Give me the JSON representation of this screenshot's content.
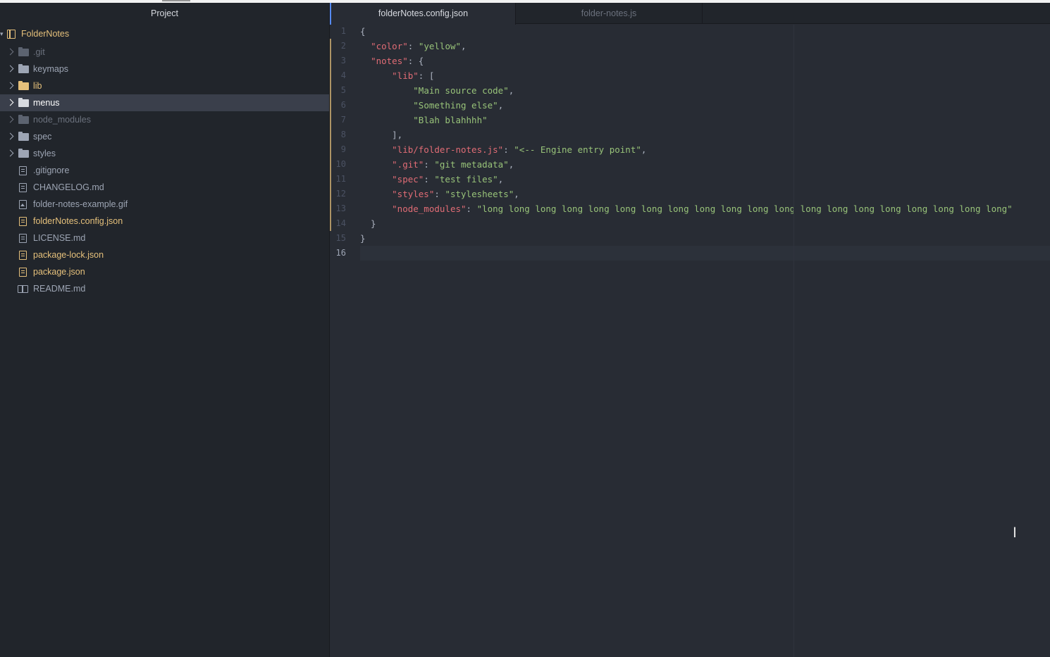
{
  "tree": {
    "header": "Project",
    "root": "FolderNotes",
    "items": [
      {
        "label": ".git",
        "kind": "folder",
        "state": "dim"
      },
      {
        "label": "keymaps",
        "kind": "folder",
        "state": ""
      },
      {
        "label": "lib",
        "kind": "folder",
        "state": "gold"
      },
      {
        "label": "menus",
        "kind": "folder",
        "state": "selected"
      },
      {
        "label": "node_modules",
        "kind": "folder",
        "state": "dim"
      },
      {
        "label": "spec",
        "kind": "folder",
        "state": ""
      },
      {
        "label": "styles",
        "kind": "folder",
        "state": ""
      },
      {
        "label": ".gitignore",
        "kind": "file",
        "state": ""
      },
      {
        "label": "CHANGELOG.md",
        "kind": "file",
        "state": ""
      },
      {
        "label": "folder-notes-example.gif",
        "kind": "image",
        "state": ""
      },
      {
        "label": "folderNotes.config.json",
        "kind": "file",
        "state": "gold"
      },
      {
        "label": "LICENSE.md",
        "kind": "file",
        "state": ""
      },
      {
        "label": "package-lock.json",
        "kind": "file",
        "state": "gold"
      },
      {
        "label": "package.json",
        "kind": "file",
        "state": "gold"
      },
      {
        "label": "README.md",
        "kind": "book",
        "state": ""
      }
    ]
  },
  "tabs": [
    {
      "label": "folderNotes.config.json",
      "active": true
    },
    {
      "label": "folder-notes.js",
      "active": false
    }
  ],
  "editor": {
    "line_numbers": [
      "1",
      "2",
      "3",
      "4",
      "5",
      "6",
      "7",
      "8",
      "9",
      "10",
      "11",
      "12",
      "13",
      "14",
      "15",
      "16"
    ],
    "lines": [
      [
        [
          "p",
          "{"
        ]
      ],
      [
        [
          "p",
          "  "
        ],
        [
          "k",
          "\"color\""
        ],
        [
          "p",
          ": "
        ],
        [
          "s",
          "\"yellow\""
        ],
        [
          "p",
          ","
        ]
      ],
      [
        [
          "p",
          "  "
        ],
        [
          "k",
          "\"notes\""
        ],
        [
          "p",
          ": {"
        ]
      ],
      [
        [
          "p",
          "      "
        ],
        [
          "k",
          "\"lib\""
        ],
        [
          "p",
          ": ["
        ]
      ],
      [
        [
          "p",
          "          "
        ],
        [
          "s",
          "\"Main source code\""
        ],
        [
          "p",
          ","
        ]
      ],
      [
        [
          "p",
          "          "
        ],
        [
          "s",
          "\"Something else\""
        ],
        [
          "p",
          ","
        ]
      ],
      [
        [
          "p",
          "          "
        ],
        [
          "s",
          "\"Blah blahhhh\""
        ]
      ],
      [
        [
          "p",
          "      ],"
        ]
      ],
      [
        [
          "p",
          "      "
        ],
        [
          "k",
          "\"lib/folder-notes.js\""
        ],
        [
          "p",
          ": "
        ],
        [
          "s",
          "\"<-- Engine entry point\""
        ],
        [
          "p",
          ","
        ]
      ],
      [
        [
          "p",
          "      "
        ],
        [
          "k",
          "\".git\""
        ],
        [
          "p",
          ": "
        ],
        [
          "s",
          "\"git metadata\""
        ],
        [
          "p",
          ","
        ]
      ],
      [
        [
          "p",
          "      "
        ],
        [
          "k",
          "\"spec\""
        ],
        [
          "p",
          ": "
        ],
        [
          "s",
          "\"test files\""
        ],
        [
          "p",
          ","
        ]
      ],
      [
        [
          "p",
          "      "
        ],
        [
          "k",
          "\"styles\""
        ],
        [
          "p",
          ": "
        ],
        [
          "s",
          "\"stylesheets\""
        ],
        [
          "p",
          ","
        ]
      ],
      [
        [
          "p",
          "      "
        ],
        [
          "k",
          "\"node_modules\""
        ],
        [
          "p",
          ": "
        ],
        [
          "s",
          "\"long long long long long long long long long long long long long long long long long long long long\""
        ]
      ],
      [
        [
          "p",
          "  }"
        ]
      ],
      [
        [
          "p",
          "}"
        ]
      ],
      [
        [
          "p",
          ""
        ]
      ]
    ],
    "modified_lines": [
      2,
      3,
      4,
      5,
      6,
      7,
      8,
      9,
      10,
      11,
      12,
      13,
      14
    ],
    "current_line": 16
  },
  "colors": {
    "key": "#e06c75",
    "string": "#98c379",
    "punctuation": "#abb2bf",
    "gold": "#e5c07b",
    "tab_accent": "#568af2"
  }
}
